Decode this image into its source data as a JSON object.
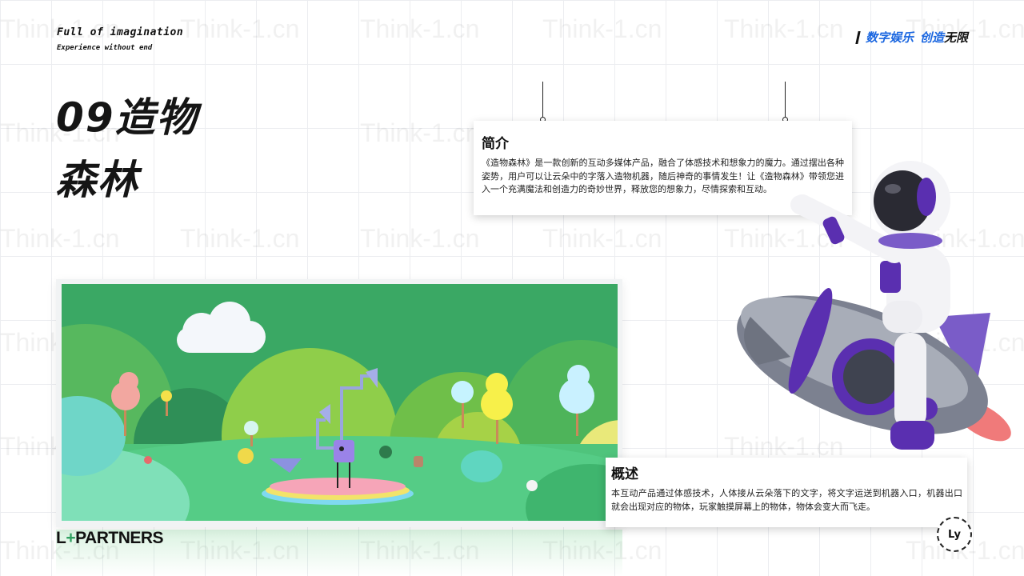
{
  "header": {
    "tagline_main": "Full of imagination",
    "tagline_sub": "Experience without end",
    "slogan_part1": "数字娱乐",
    "slogan_part2": "创造",
    "slogan_part3": "无限"
  },
  "title": {
    "line1": "09造物",
    "line2": "森林"
  },
  "intro_card": {
    "heading": "简介",
    "body": "《造物森林》是一款创新的互动多媒体产品，融合了体感技术和想象力的魔力。通过摆出各种姿势，用户可以让云朵中的字落入造物机器，随后神奇的事情发生！让《造物森林》带领您进入一个充满魔法和创造力的奇妙世界，释放您的想象力，尽情探索和互动。"
  },
  "overview_card": {
    "heading": "概述",
    "body": "本互动产品通过体感技术，人体接从云朵落下的文字，将文字运送到机器入口，机器出口就会出现对应的物体，玩家触摸屏幕上的物体，物体会变大而飞走。"
  },
  "footer": {
    "logo_left": "L",
    "logo_plus": "+",
    "logo_right": "PARTNERS",
    "badge_text": "Ly"
  },
  "watermark_text": "Think-1.cn",
  "colors": {
    "accent_blue": "#1a66e0",
    "scene_green": "#3bb56a",
    "astronaut_purple": "#5a2fb0"
  }
}
